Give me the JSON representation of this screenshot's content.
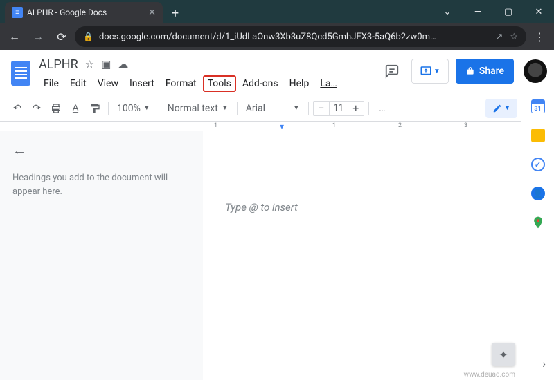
{
  "browser": {
    "tab_title": "ALPHR - Google Docs",
    "url": "docs.google.com/document/d/1_iUdLaOnw3Xb3uZ8Qcd5GmhJEX3-5aQ6b2zw0m…",
    "new_tab": "+",
    "win": {
      "min": "—",
      "max": "▢",
      "close": "✕",
      "caret": "⌄"
    }
  },
  "docs": {
    "title": "ALPHR",
    "menus": [
      "File",
      "Edit",
      "View",
      "Insert",
      "Format",
      "Tools",
      "Add-ons",
      "Help",
      "La…"
    ],
    "highlighted_menu_index": 5,
    "share": "Share"
  },
  "toolbar": {
    "zoom": "100%",
    "style": "Normal text",
    "font": "Arial",
    "font_size": "11",
    "more": "…"
  },
  "ruler": {
    "ticks": [
      "1",
      "1",
      "2",
      "3"
    ]
  },
  "outline": {
    "message": "Headings you add to the document will appear here."
  },
  "document": {
    "placeholder": "Type @ to insert"
  },
  "sidepanel": {
    "icons": [
      "calendar",
      "keep",
      "tasks",
      "contacts",
      "maps"
    ]
  },
  "watermark": "www.deuaq.com"
}
